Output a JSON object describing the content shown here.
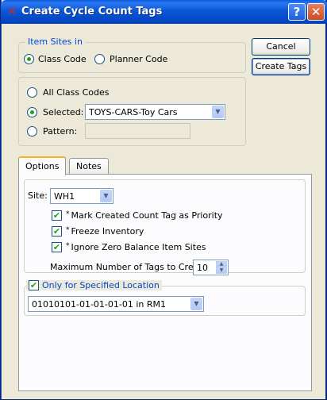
{
  "window": {
    "title": "Create Cycle Count Tags",
    "help_glyph": "?",
    "close_glyph": "✕",
    "app_icon": "x-icon"
  },
  "buttons": {
    "cancel": "Cancel",
    "create": "Create Tags"
  },
  "item_sites": {
    "legend": "Item Sites in",
    "class_code": "Class Code",
    "planner_code": "Planner Code",
    "selected_mode": "Class Code"
  },
  "selection": {
    "all": "All Class Codes",
    "selected": "Selected:",
    "selected_value": "TOYS-CARS-Toy Cars",
    "pattern": "Pattern:",
    "pattern_value": "",
    "current": "Selected"
  },
  "tabs": [
    {
      "label": "Options",
      "active": true
    },
    {
      "label": "Notes",
      "active": false
    }
  ],
  "options": {
    "site_label": "Site:",
    "site_value": "WH1",
    "mark_priority": {
      "label": "Mark Created Count Tag as Priority",
      "checked": true
    },
    "freeze_inventory": {
      "label": "Freeze Inventory",
      "checked": true
    },
    "ignore_zero": {
      "label": "Ignore Zero Balance Item Sites",
      "checked": true
    },
    "max_tags_label": "Maximum Number of Tags to Create:",
    "max_tags_value": "10",
    "only_location": {
      "label": "Only for Specified Location",
      "checked": true
    },
    "location_value": "01010101-01-01-01-01 in RM1"
  },
  "glyphs": {
    "check": "✔",
    "arrow": "▼",
    "up": "▲",
    "down": "▼",
    "star": "*"
  }
}
